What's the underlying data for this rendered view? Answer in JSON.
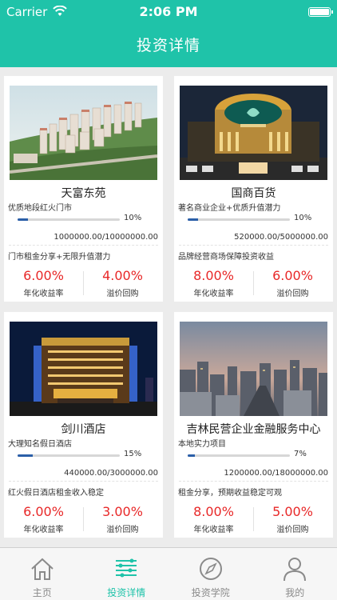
{
  "status_bar": {
    "carrier": "Carrier",
    "time": "2:06 PM"
  },
  "nav": {
    "title": "投资详情"
  },
  "projects": [
    {
      "name": "天富东苑",
      "subtitle": "优质地段红火门市",
      "progress_pct": 10,
      "progress_text": "10%",
      "amount": "1000000.00/10000000.00",
      "desc": "门市租金分享+无限升值潜力",
      "rate_annual": "6.00%",
      "rate_annual_label": "年化收益率",
      "rate_premium": "4.00%",
      "rate_premium_label": "溢价回购",
      "image": "residential-complex-aerial"
    },
    {
      "name": "国商百货",
      "subtitle": "著名商业企业+优质升值潜力",
      "progress_pct": 10,
      "progress_text": "10%",
      "amount": "520000.00/5000000.00",
      "desc": "品牌经营商场保障投资收益",
      "rate_annual": "8.00%",
      "rate_annual_label": "年化收益率",
      "rate_premium": "6.00%",
      "rate_premium_label": "溢价回购",
      "image": "department-store-night"
    },
    {
      "name": "剑川酒店",
      "subtitle": "大理知名假日酒店",
      "progress_pct": 15,
      "progress_text": "15%",
      "amount": "440000.00/3000000.00",
      "desc": "红火假日酒店租金收入稳定",
      "rate_annual": "6.00%",
      "rate_annual_label": "年化收益率",
      "rate_premium": "3.00%",
      "rate_premium_label": "溢价回购",
      "image": "hotel-night"
    },
    {
      "name": "吉林民营企业金融服务中心",
      "subtitle": "本地实力项目",
      "progress_pct": 7,
      "progress_text": "7%",
      "amount": "1200000.00/18000000.00",
      "desc": "租金分享，预期收益稳定可观",
      "rate_annual": "8.00%",
      "rate_annual_label": "年化收益率",
      "rate_premium": "5.00%",
      "rate_premium_label": "溢价回购",
      "image": "city-skyline-dusk"
    }
  ],
  "tabs": [
    {
      "label": "主页",
      "icon": "home-icon",
      "active": false
    },
    {
      "label": "投资详情",
      "icon": "list-icon",
      "active": true
    },
    {
      "label": "投资学院",
      "icon": "compass-icon",
      "active": false
    },
    {
      "label": "我的",
      "icon": "user-icon",
      "active": false
    }
  ],
  "colors": {
    "accent": "#1fc3a9",
    "rate": "#e82828",
    "progress": "#2b5fa8"
  }
}
